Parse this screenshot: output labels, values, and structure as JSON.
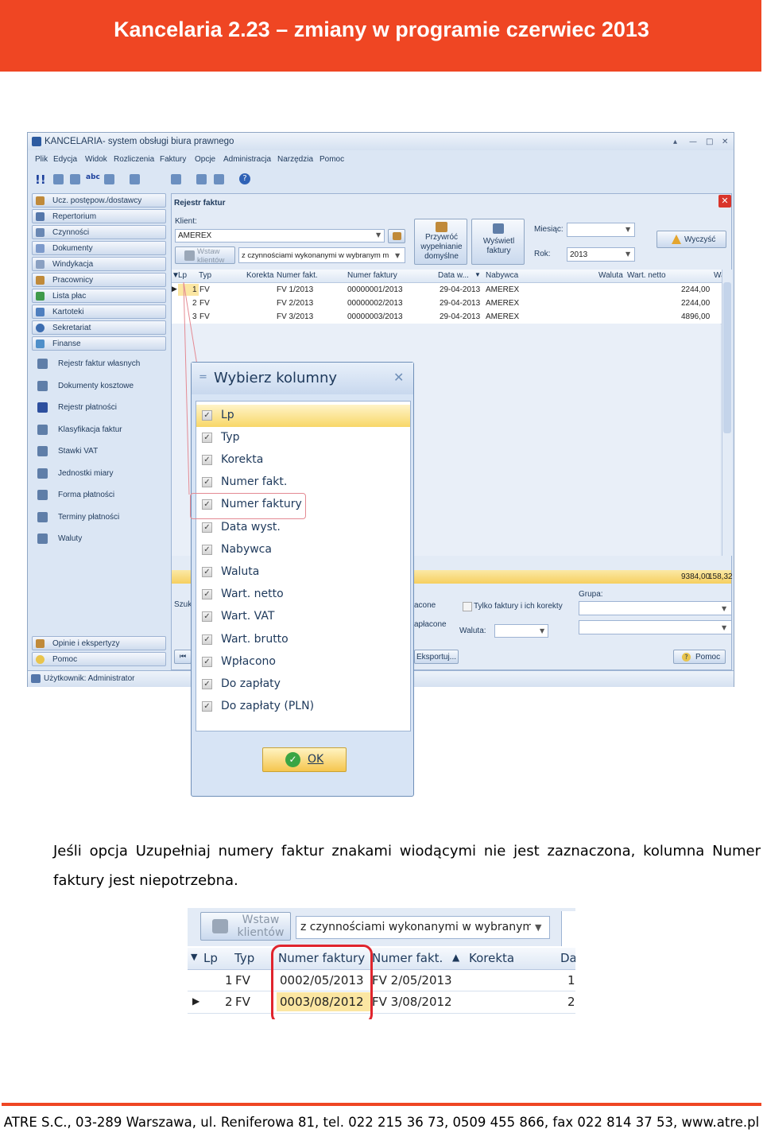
{
  "header": {
    "title": "Kancelaria 2.23 – zmiany w programie czerwiec 2013",
    "color": "#ef4623"
  },
  "window": {
    "title": "KANCELARIA- system obsługi biura prawnego",
    "menu": [
      "Plik",
      "Edycja",
      "Widok",
      "Rozliczenia",
      "Faktury",
      "Opcje",
      "Administracja",
      "Narzędzia",
      "Pomoc"
    ],
    "nav": [
      "Ucz. postępow./dostawcy",
      "Repertorium",
      "Czynności",
      "Dokumenty",
      "Windykacja",
      "Pracownicy",
      "Lista płac",
      "Kartoteki",
      "Sekretariat",
      "Finanse"
    ],
    "subnav": [
      "Rejestr faktur własnych",
      "Dokumenty kosztowe",
      "Rejestr płatności",
      "Klasyfikacja faktur",
      "Stawki VAT",
      "Jednostki miary",
      "Forma płatności",
      "Terminy płatności",
      "Waluty"
    ],
    "nav_bottom": [
      "Opinie i ekspertyzy",
      "Pomoc"
    ],
    "status": "Użytkownik: Administrator"
  },
  "panel": {
    "title": "Rejestr faktur",
    "client_label": "Klient:",
    "client_value": "AMEREX",
    "insert_clients": "Wstaw klientów",
    "activity_filter": "z czynnościami wykonanymi w wybranym m",
    "restore_btn": "Przywróć wypełnianie domyślne",
    "show_btn": "Wyświetl faktury",
    "month_label": "Miesiąc:",
    "year_label": "Rok:",
    "year_value": "2013",
    "clear_btn": "Wyczyść",
    "columns": [
      "Lp",
      "Typ",
      "Korekta",
      "Numer fakt.",
      "Numer faktury",
      "Data w...",
      "Nabywca",
      "Waluta",
      "Wart. netto",
      "Wa"
    ],
    "rows": [
      {
        "lp": "1",
        "typ": "FV",
        "numer": "FV 1/2013",
        "numer_faktury": "00000001/2013",
        "data": "29-04-2013",
        "nabywca": "AMEREX",
        "netto": "2244,00"
      },
      {
        "lp": "2",
        "typ": "FV",
        "numer": "FV 2/2013",
        "numer_faktury": "00000002/2013",
        "data": "29-04-2013",
        "nabywca": "AMEREX",
        "netto": "2244,00"
      },
      {
        "lp": "3",
        "typ": "FV",
        "numer": "FV 3/2013",
        "numer_faktury": "00000003/2013",
        "data": "29-04-2013",
        "nabywca": "AMEREX",
        "netto": "4896,00"
      }
    ],
    "totals": "9384,00",
    "totals2": "158,32",
    "search_label": "Szuk",
    "paid_label": "acone",
    "unpaid_label": "apłacone",
    "only_corrections": "Tylko faktury i ich korekty",
    "currency_label": "Waluta:",
    "group_label": "Grupa:",
    "export_btn": "Eksportuj...",
    "help_btn": "Pomoc"
  },
  "dialog": {
    "title": "Wybierz kolumny",
    "options": [
      "Lp",
      "Typ",
      "Korekta",
      "Numer fakt.",
      "Numer faktury",
      "Data wyst.",
      "Nabywca",
      "Waluta",
      "Wart. netto",
      "Wart. VAT",
      "Wart. brutto",
      "Wpłacono",
      "Do zapłaty",
      "Do zapłaty (PLN)"
    ],
    "ok": "OK"
  },
  "paragraph": "Jeśli opcja Uzupełniaj numery faktur znakami wiodącymi nie jest zaznaczona, kolumna Numer faktury jest niepotrzebna.",
  "zoom": {
    "insert_clients": "Wstaw klientów",
    "activity_filter": "z czynnościami wykonanymi w wybranym r",
    "columns": [
      "Lp",
      "Typ",
      "Numer faktury",
      "Numer fakt.",
      "Korekta",
      "Da"
    ],
    "rows": [
      {
        "lp": "1",
        "typ": "FV",
        "numer_faktury": "0002/05/2013",
        "numer": "FV 2/05/2013",
        "da": "1"
      },
      {
        "lp": "2",
        "typ": "FV",
        "numer_faktury": "0003/08/2012",
        "numer": "FV 3/08/2012",
        "da": "2"
      }
    ]
  },
  "footer": {
    "text": "ATRE S.C., 03-289 Warszawa, ul. Reniferowa 81, tel. 022 215 36 73, 0509 455 866, fax 022 814 37 53, www.atre.pl"
  }
}
